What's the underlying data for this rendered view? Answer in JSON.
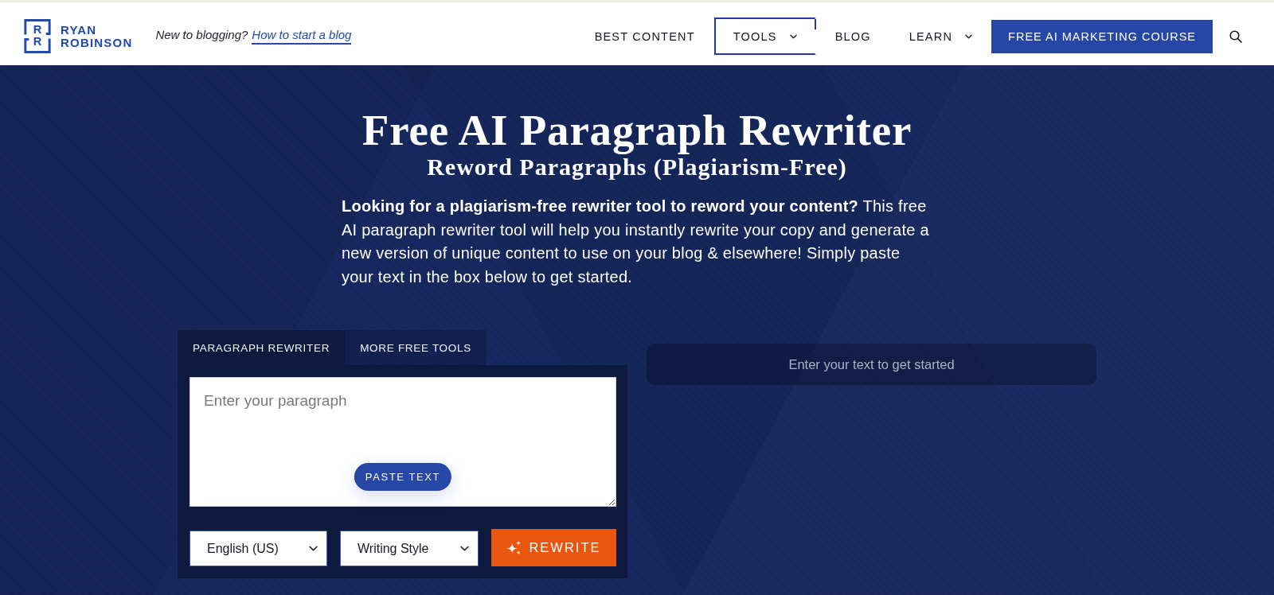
{
  "header": {
    "logo": {
      "mark_letters": [
        "R",
        "R"
      ],
      "name_lines": [
        "RYAN",
        "ROBINSON"
      ]
    },
    "tagline": {
      "text": "New to blogging?",
      "link": "How to start a blog"
    },
    "nav": [
      {
        "label": "BEST CONTENT",
        "has_dropdown": false,
        "selected": false
      },
      {
        "label": "TOOLS",
        "has_dropdown": true,
        "selected": true
      },
      {
        "label": "BLOG",
        "has_dropdown": false,
        "selected": false
      },
      {
        "label": "LEARN",
        "has_dropdown": true,
        "selected": false
      }
    ],
    "cta_button": "FREE AI MARKETING COURSE"
  },
  "hero": {
    "title": "Free AI Paragraph Rewriter",
    "subtitle": "Reword Paragraphs (Plagiarism-Free)",
    "intro": "**Looking for a plagiarism-free rewriter tool to reword your content?** This free AI paragraph rewriter tool will help you instantly rewrite your copy and generate a new version of unique content to use on your blog & elsewhere! Simply paste your text in the box below to get started."
  },
  "rewriter": {
    "tabs": [
      {
        "label": "PARAGRAPH REWRITER",
        "selected": true
      },
      {
        "label": "MORE FREE TOOLS",
        "selected": false
      }
    ],
    "input": {
      "placeholder": "Enter your paragraph"
    },
    "paste_button": "PASTE TEXT",
    "language_select": {
      "value": "English (US)"
    },
    "style_select": {
      "value": "Writing Style"
    },
    "rewrite_button": "REWRITE"
  },
  "output": {
    "message": "Enter your text to get started"
  }
}
